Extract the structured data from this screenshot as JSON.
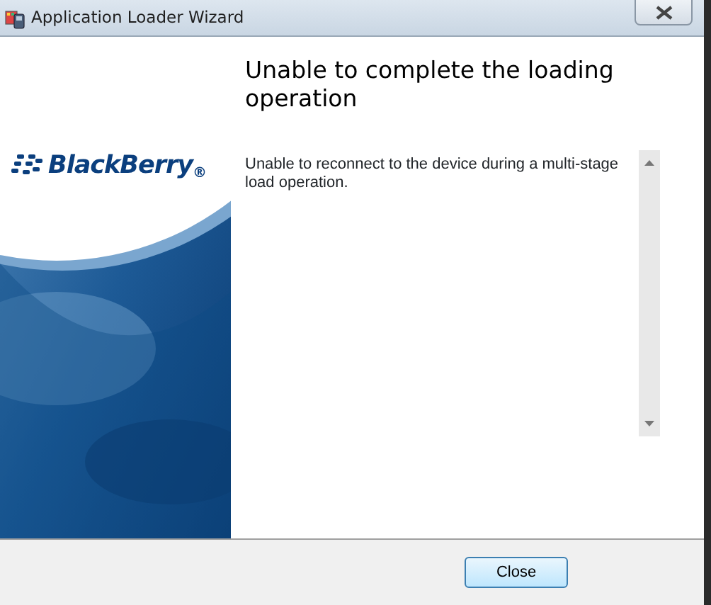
{
  "window": {
    "title": "Application Loader Wizard"
  },
  "sidebar": {
    "brand": "BlackBerry$_{®}$"
  },
  "heading": "Unable to complete the loading operation",
  "message": "Unable to reconnect to the device during a multi-stage load operation.",
  "buttons": [
    {
      "label": "Close"
    }
  ]
}
